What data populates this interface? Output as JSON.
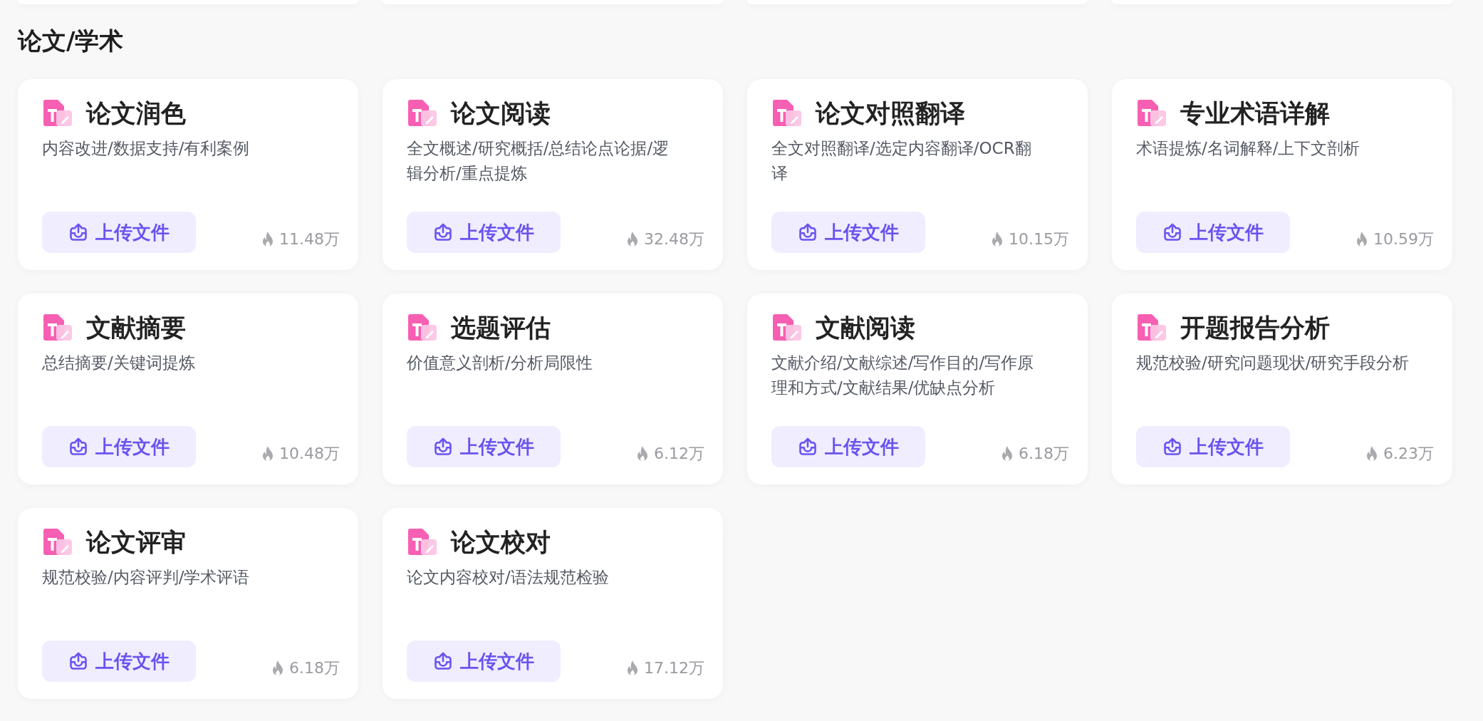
{
  "section": {
    "title": "论文/学术"
  },
  "cards": [
    {
      "title": "论文润色",
      "description": "内容改进/数据支持/有利案例",
      "button": "上传文件",
      "count": "11.48万"
    },
    {
      "title": "论文阅读",
      "description": "全文概述/研究概括/总结论点论据/逻辑分析/重点提炼",
      "button": "上传文件",
      "count": "32.48万"
    },
    {
      "title": "论文对照翻译",
      "description": "全文对照翻译/选定内容翻译/OCR翻译",
      "button": "上传文件",
      "count": "10.15万"
    },
    {
      "title": "专业术语详解",
      "description": "术语提炼/名词解释/上下文剖析",
      "button": "上传文件",
      "count": "10.59万"
    },
    {
      "title": "文献摘要",
      "description": "总结摘要/关键词提炼",
      "button": "上传文件",
      "count": "10.48万"
    },
    {
      "title": "选题评估",
      "description": "价值意义剖析/分析局限性",
      "button": "上传文件",
      "count": "6.12万"
    },
    {
      "title": "文献阅读",
      "description": "文献介绍/文献综述/写作目的/写作原理和方式/文献结果/优缺点分析",
      "button": "上传文件",
      "count": "6.18万"
    },
    {
      "title": "开题报告分析",
      "description": "规范校验/研究问题现状/研究手段分析",
      "button": "上传文件",
      "count": "6.23万"
    },
    {
      "title": "论文评审",
      "description": "规范校验/内容评判/学术评语",
      "button": "上传文件",
      "count": "6.18万"
    },
    {
      "title": "论文校对",
      "description": "论文内容校对/语法规范检验",
      "button": "上传文件",
      "count": "17.12万"
    }
  ]
}
